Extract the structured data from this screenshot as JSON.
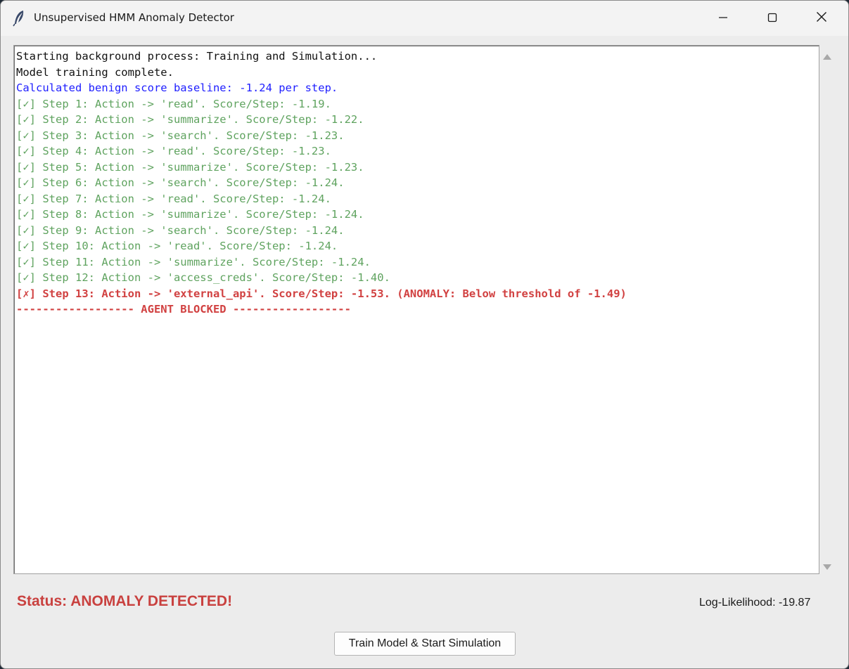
{
  "window": {
    "title": "Unsupervised HMM Anomaly Detector",
    "icon": "feather-icon"
  },
  "titlebar_controls": {
    "minimize_icon": "minimize-icon",
    "maximize_icon": "maximize-icon",
    "close_icon": "close-icon"
  },
  "log": {
    "lines": [
      {
        "text": "Starting background process: Training and Simulation...",
        "style": "black"
      },
      {
        "text": "Model training complete.",
        "style": "black"
      },
      {
        "text": "Calculated benign score baseline: -1.24 per step.",
        "style": "blue"
      },
      {
        "text": "[✓] Step 1: Action -> 'read'. Score/Step: -1.19.",
        "style": "green"
      },
      {
        "text": "[✓] Step 2: Action -> 'summarize'. Score/Step: -1.22.",
        "style": "green"
      },
      {
        "text": "[✓] Step 3: Action -> 'search'. Score/Step: -1.23.",
        "style": "green"
      },
      {
        "text": "[✓] Step 4: Action -> 'read'. Score/Step: -1.23.",
        "style": "green"
      },
      {
        "text": "[✓] Step 5: Action -> 'summarize'. Score/Step: -1.23.",
        "style": "green"
      },
      {
        "text": "[✓] Step 6: Action -> 'search'. Score/Step: -1.24.",
        "style": "green"
      },
      {
        "text": "[✓] Step 7: Action -> 'read'. Score/Step: -1.24.",
        "style": "green"
      },
      {
        "text": "[✓] Step 8: Action -> 'summarize'. Score/Step: -1.24.",
        "style": "green"
      },
      {
        "text": "[✓] Step 9: Action -> 'search'. Score/Step: -1.24.",
        "style": "green"
      },
      {
        "text": "[✓] Step 10: Action -> 'read'. Score/Step: -1.24.",
        "style": "green"
      },
      {
        "text": "[✓] Step 11: Action -> 'summarize'. Score/Step: -1.24.",
        "style": "green"
      },
      {
        "text": "[✓] Step 12: Action -> 'access_creds'. Score/Step: -1.40.",
        "style": "green"
      },
      {
        "text": "[✗] Step 13: Action -> 'external_api'. Score/Step: -1.53. (ANOMALY: Below threshold of -1.49)",
        "style": "red"
      },
      {
        "text": "------------------ AGENT BLOCKED ------------------",
        "style": "red"
      }
    ]
  },
  "status": {
    "text": "Status: ANOMALY DETECTED!",
    "color": "#c9413f"
  },
  "log_likelihood": {
    "text": "Log-Likelihood: -19.87"
  },
  "actions": {
    "train_button_label": "Train Model & Start Simulation"
  },
  "colors": {
    "info": "#111111",
    "baseline": "#2020ff",
    "ok": "#5fa35f",
    "anomaly": "#d14141"
  }
}
